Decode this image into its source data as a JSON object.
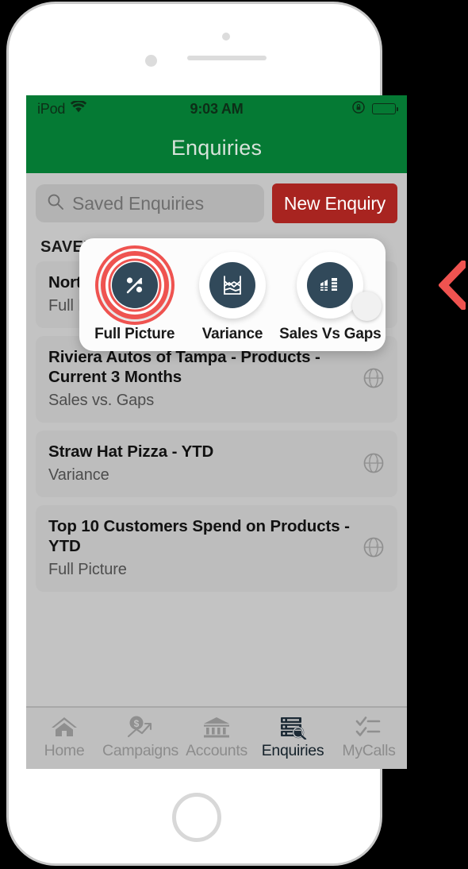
{
  "status_bar": {
    "carrier": "iPod",
    "wifi_icon": "wifi-icon",
    "time": "9:03 AM",
    "rotation_lock_icon": "rotation-lock-icon",
    "battery_icon": "battery-full-icon"
  },
  "nav": {
    "title": "Enquiries"
  },
  "search": {
    "placeholder": "Saved Enquiries",
    "value": "",
    "icon": "search-icon"
  },
  "actions": {
    "new_enquiry_label": "New Enquiry"
  },
  "section": {
    "saved_label": "SAVED"
  },
  "popup": {
    "options": [
      {
        "label": "Full Picture",
        "icon": "full-picture-icon",
        "selected": true
      },
      {
        "label": "Variance",
        "icon": "variance-chart-icon",
        "selected": false
      },
      {
        "label": "Sales Vs Gaps",
        "icon": "sales-vs-gaps-icon",
        "selected": false
      }
    ]
  },
  "enquiries": [
    {
      "title": "North Coast Trading Company - YTD",
      "subtitle": "Full Picture",
      "icon": "globe-icon"
    },
    {
      "title": "Riviera Autos of Tampa - Products - Current 3 Months",
      "subtitle": "Sales vs. Gaps",
      "icon": "globe-icon"
    },
    {
      "title": "Straw Hat Pizza - YTD",
      "subtitle": "Variance",
      "icon": "globe-icon"
    },
    {
      "title": "Top 10 Customers Spend on Products - YTD",
      "subtitle": "Full Picture",
      "icon": "globe-icon"
    }
  ],
  "tab_bar": {
    "items": [
      {
        "label": "Home",
        "icon": "home-icon",
        "active": false
      },
      {
        "label": "Campaigns",
        "icon": "campaigns-dollar-growth-icon",
        "active": false
      },
      {
        "label": "Accounts",
        "icon": "bank-building-icon",
        "active": false
      },
      {
        "label": "Enquiries",
        "icon": "server-search-icon",
        "active": true
      },
      {
        "label": "MyCalls",
        "icon": "checklist-icon",
        "active": false
      }
    ]
  },
  "annotation": {
    "chevron_icon": "left-chevron-annotation-icon"
  },
  "cursor": {
    "icon": "touch-cursor-icon"
  },
  "colors": {
    "header_green": "#057A34",
    "button_red": "#A82420",
    "icon_navy": "#31495A",
    "ripple_red": "#EF5350",
    "annotation_red": "#EF5350",
    "screen_bg": "#C3C3C3"
  }
}
